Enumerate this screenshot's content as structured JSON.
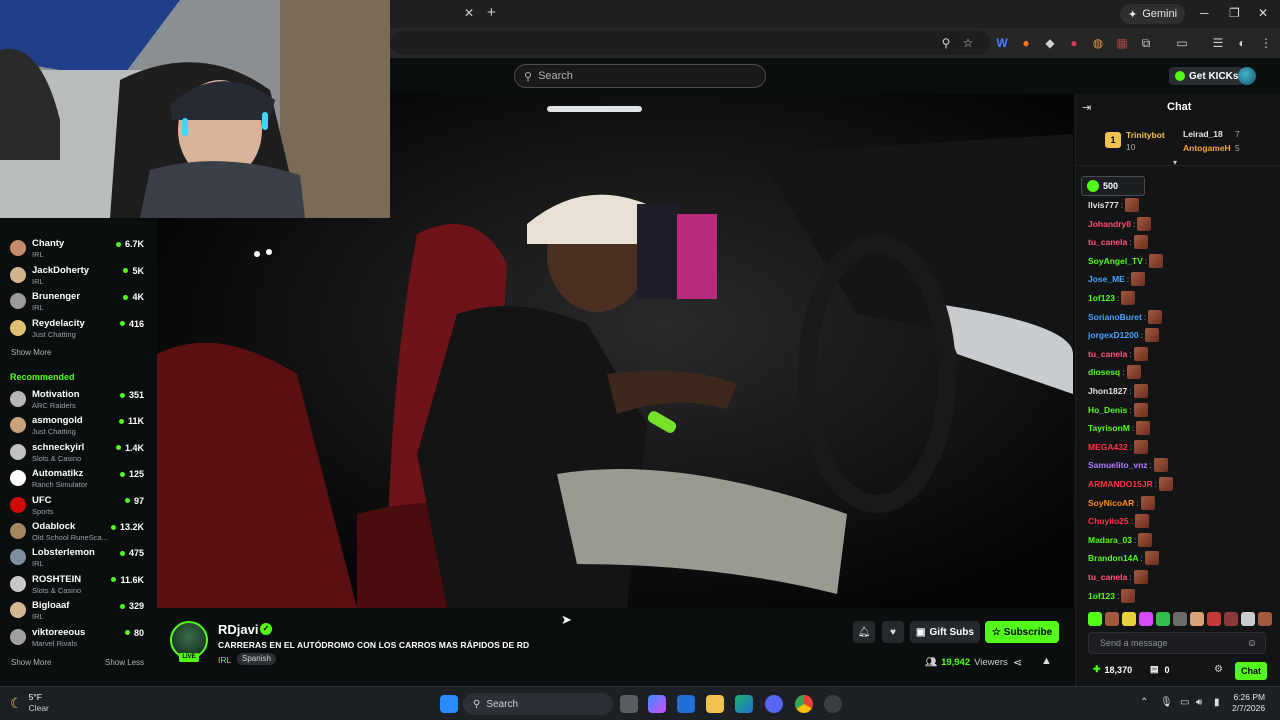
{
  "browser": {
    "tab_close_icon": "close-icon",
    "gemini_label": "Gemini"
  },
  "site": {
    "search_placeholder": "Search",
    "get_kicks_label": "Get KICKs"
  },
  "sidebar": {
    "following": [
      {
        "name": "Chanty",
        "category": "IRL",
        "viewers": "6.7K",
        "color": "#c48a6a"
      },
      {
        "name": "JackDoherty",
        "category": "IRL",
        "viewers": "5K",
        "color": "#d2b48c"
      },
      {
        "name": "Brunenger",
        "category": "IRL",
        "viewers": "4K",
        "color": "#9a9a9a"
      },
      {
        "name": "Reydelacity",
        "category": "Just Chatting",
        "viewers": "416",
        "color": "#e0c070"
      }
    ],
    "show_more_1": "Show More",
    "recommended_title": "Recommended",
    "recommended": [
      {
        "name": "Motivation",
        "category": "ARC Raiders",
        "viewers": "351",
        "color": "#b7b7b7"
      },
      {
        "name": "asmongold",
        "category": "Just Chatting",
        "viewers": "11K",
        "color": "#c9a27a"
      },
      {
        "name": "schneckyirl",
        "category": "Slots & Casino",
        "viewers": "1.4K",
        "color": "#c0c0c0"
      },
      {
        "name": "Automatikz",
        "category": "Ranch Simulator",
        "viewers": "125",
        "color": "#ffffff"
      },
      {
        "name": "UFC",
        "category": "Sports",
        "viewers": "97",
        "color": "#d20a0a"
      },
      {
        "name": "Odablock",
        "category": "Old School RuneSca...",
        "viewers": "13.2K",
        "color": "#a58660"
      },
      {
        "name": "Lobsterlemon",
        "category": "IRL",
        "viewers": "475",
        "color": "#7e8fa0"
      },
      {
        "name": "ROSHTEIN",
        "category": "Slots & Casino",
        "viewers": "11.6K",
        "color": "#c8c8c8"
      },
      {
        "name": "Bigloaaf",
        "category": "IRL",
        "viewers": "329",
        "color": "#d4b894"
      },
      {
        "name": "viktoreeous",
        "category": "Marvel Rivals",
        "viewers": "80",
        "color": "#a0a0a0"
      }
    ],
    "show_more_2": "Show More",
    "show_less": "Show Less"
  },
  "stream": {
    "streamer": "RDjavi",
    "live_badge": "LIVE",
    "title": "CARRERAS EN EL AUTÓDROMO CON LOS CARROS MAS RÁPIDOS DE RD",
    "category": "IRL",
    "language": "Spanish",
    "gift_subs_label": "Gift Subs",
    "subscribe_label": "Subscribe",
    "viewers_count": "19,942",
    "viewers_label": "Viewers"
  },
  "chat": {
    "title": "Chat",
    "leaderboard": [
      {
        "rank": "1",
        "name": "Trinitybot",
        "count": "10",
        "color": "#f2c14e"
      },
      {
        "name": "Leirad_18",
        "count": "7",
        "color": "#e6e6e6"
      },
      {
        "name": "AntogameH",
        "count": "5",
        "color": "#f2a541"
      }
    ],
    "pinned_amount": "500",
    "messages": [
      {
        "user": "llvis777",
        "color": "#e0e0e0"
      },
      {
        "user": "Johandry8",
        "color": "#ff4d6a"
      },
      {
        "user": "tu_canela",
        "color": "#ff5c7a"
      },
      {
        "user": "SoyAngel_TV",
        "color": "#53fc18"
      },
      {
        "user": "Jose_ME",
        "color": "#4aa3ff"
      },
      {
        "user": "1of123",
        "color": "#53fc18"
      },
      {
        "user": "SorianoBuret",
        "color": "#4aa3ff"
      },
      {
        "user": "jorgexD1200",
        "color": "#4aa3ff"
      },
      {
        "user": "tu_canela",
        "color": "#ff5c7a"
      },
      {
        "user": "diosesq",
        "color": "#53fc18"
      },
      {
        "user": "Jhon1827",
        "color": "#e0e0e0"
      },
      {
        "user": "Ho_Denis",
        "color": "#53fc18"
      },
      {
        "user": "TayrisonM",
        "color": "#53fc18"
      },
      {
        "user": "MEGA432",
        "color": "#ff3344"
      },
      {
        "user": "Samuelito_vnz",
        "color": "#b27cff"
      },
      {
        "user": "ARMANDO15JR",
        "color": "#ff3344"
      },
      {
        "user": "SoyNicoAR",
        "color": "#ff8c1a"
      },
      {
        "user": "Chuyllo25",
        "color": "#ff3344"
      },
      {
        "user": "Madara_03",
        "color": "#53fc18"
      },
      {
        "user": "Brandon14A",
        "color": "#53fc18"
      },
      {
        "user": "tu_canela",
        "color": "#ff5c7a"
      },
      {
        "user": "1of123",
        "color": "#53fc18"
      }
    ],
    "input_placeholder": "Send a message",
    "kicks_balance": "18,370",
    "points": "0",
    "chat_button": "Chat"
  },
  "taskbar": {
    "temperature": "5°F",
    "weather": "Clear",
    "search_label": "Search",
    "time": "6:26 PM",
    "date": "2/7/2026"
  }
}
